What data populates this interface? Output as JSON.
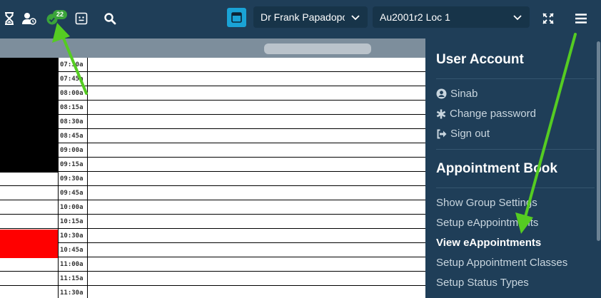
{
  "topbar": {
    "icons": [
      "hourglass-icon",
      "user-clock-icon",
      "eappointments-icon",
      "id-card-icon",
      "search-icon"
    ],
    "notification_count": "22",
    "practitioner_select": {
      "value": "Dr Frank Papadopo"
    },
    "location_select": {
      "value": "Au2001r2 Loc 1"
    },
    "right_icons": [
      "fullscreen-icon",
      "hamburger-menu-icon"
    ]
  },
  "schedule": {
    "times": [
      "07:30a",
      "07:45a",
      "08:00a",
      "08:15a",
      "08:30a",
      "08:45a",
      "09:00a",
      "09:15a",
      "09:30a",
      "09:45a",
      "10:00a",
      "10:15a",
      "10:30a",
      "10:45a",
      "11:00a",
      "11:15a",
      "11:30a"
    ]
  },
  "menu": {
    "user_account": {
      "title": "User Account",
      "username": "Sinab",
      "change_password": "Change password",
      "sign_out": "Sign out"
    },
    "appointment_book": {
      "title": "Appointment Book",
      "items": [
        "Show Group Settings",
        "Setup eAppointments",
        "View eAppointments",
        "Setup Appointment Classes",
        "Setup Status Types"
      ],
      "active_item": "View eAppointments"
    }
  },
  "colors": {
    "topbar": "#1f3e58",
    "accent": "#1aa3d6",
    "annotation_arrow": "#55cc22",
    "booked_red": "#ff0000"
  }
}
